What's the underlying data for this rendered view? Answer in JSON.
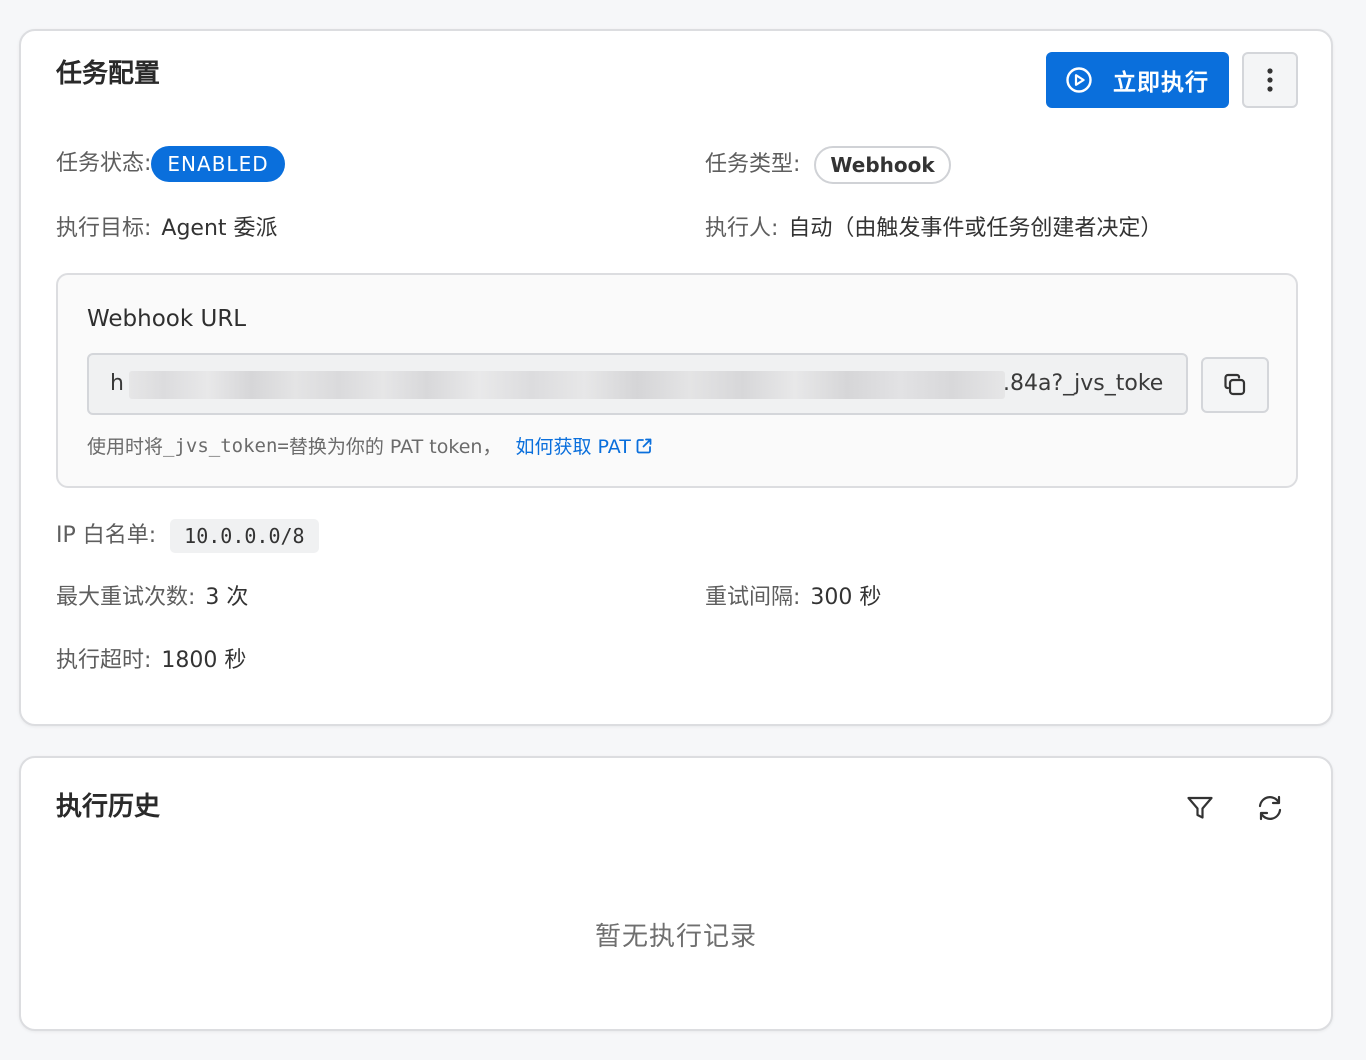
{
  "config": {
    "title": "任务配置",
    "run_now_label": "立即执行",
    "status_label": "任务状态:",
    "status_value": "ENABLED",
    "type_label": "任务类型:",
    "type_value": "Webhook",
    "target_label": "执行目标:",
    "target_value": "Agent 委派",
    "executor_label": "执行人:",
    "executor_value": "自动（由触发事件或任务创建者决定）",
    "webhook": {
      "title": "Webhook URL",
      "url_start": "h",
      "url_end": ".84a?_jvs_toke",
      "hint_prefix": "使用时将 ",
      "hint_code": "_jvs_token=",
      "hint_suffix": " 替换为你的 PAT token，",
      "hint_link": "如何获取 PAT"
    },
    "ip_label": "IP 白名单:",
    "ip_value": "10.0.0.0/8",
    "max_retry_label": "最大重试次数:",
    "max_retry_value": "3 次",
    "retry_interval_label": "重试间隔:",
    "retry_interval_value": "300 秒",
    "timeout_label": "执行超时:",
    "timeout_value": "1800 秒"
  },
  "history": {
    "title": "执行历史",
    "empty_text": "暂无执行记录"
  },
  "icons": {
    "run": "play-circle-icon",
    "more": "more-vertical-icon",
    "copy": "copy-icon",
    "external": "external-link-icon",
    "filter": "filter-icon",
    "refresh": "refresh-icon"
  },
  "colors": {
    "primary": "#0a6fdc",
    "background": "#f6f7f9",
    "card": "#ffffff",
    "border": "#dcdde0"
  }
}
